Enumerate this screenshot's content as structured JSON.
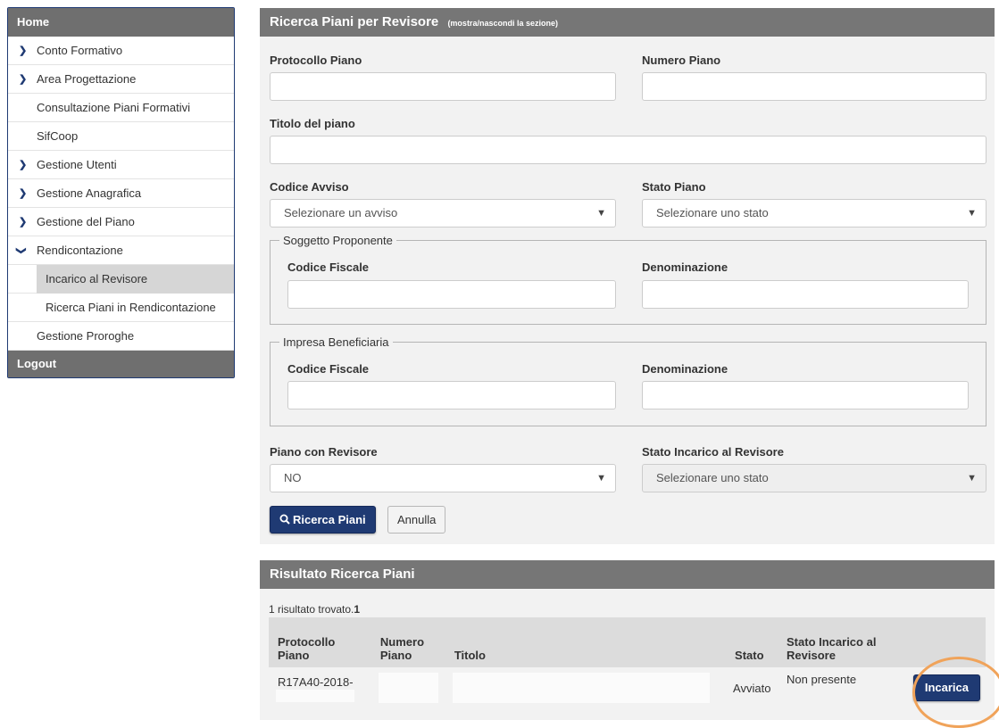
{
  "sidebar": {
    "home": "Home",
    "items": [
      {
        "label": "Conto Formativo",
        "icon": "chevron-right-icon",
        "glyph": "❯"
      },
      {
        "label": "Area Progettazione",
        "icon": "chevron-right-icon",
        "glyph": "❯"
      },
      {
        "label": "Consultazione Piani Formativi"
      },
      {
        "label": "SifCoop"
      },
      {
        "label": "Gestione Utenti",
        "icon": "chevron-right-icon",
        "glyph": "❯"
      },
      {
        "label": "Gestione Anagrafica",
        "icon": "chevron-right-icon",
        "glyph": "❯"
      },
      {
        "label": "Gestione del Piano",
        "icon": "chevron-right-icon",
        "glyph": "❯"
      },
      {
        "label": "Rendicontazione",
        "icon": "chevron-down-icon",
        "glyph": "❯"
      },
      {
        "label": "Incarico al Revisore",
        "active": true
      },
      {
        "label": "Ricerca Piani in Rendicontazione"
      },
      {
        "label": "Gestione Proroghe"
      }
    ],
    "logout": "Logout"
  },
  "search_panel": {
    "title": "Ricerca Piani per Revisore",
    "toggle": "(mostra/nascondi la sezione)",
    "protocollo_label": "Protocollo Piano",
    "protocollo_value": "",
    "numero_label": "Numero Piano",
    "numero_value": "",
    "titolo_label": "Titolo del piano",
    "titolo_value": "",
    "codice_avviso_label": "Codice Avviso",
    "codice_avviso_value": "Selezionare un avviso",
    "stato_piano_label": "Stato Piano",
    "stato_piano_value": "Selezionare uno stato",
    "soggetto": {
      "legend": "Soggetto Proponente",
      "cf_label": "Codice Fiscale",
      "den_label": "Denominazione"
    },
    "impresa": {
      "legend": "Impresa Beneficiaria",
      "cf_label": "Codice Fiscale",
      "den_label": "Denominazione"
    },
    "piano_revisore_label": "Piano con Revisore",
    "piano_revisore_value": "NO",
    "stato_incarico_label": "Stato Incarico al Revisore",
    "stato_incarico_value": "Selezionare uno stato",
    "search_button": "Ricerca Piani",
    "cancel_button": "Annulla",
    "dropdown_glyph": "▼",
    "search_glyph": "🔍"
  },
  "results": {
    "title": "Risultato Ricerca Piani",
    "count_text": "1 risultato trovato.",
    "count_bold": "1",
    "headers": {
      "protocollo_1": "Protocollo",
      "protocollo_2": "Piano",
      "numero_1": "Numero",
      "numero_2": "Piano",
      "titolo": "Titolo",
      "stato": "Stato",
      "incarico_1": "Stato Incarico al",
      "incarico_2": "Revisore"
    },
    "row": {
      "protocollo": "R17A40-2018-",
      "stato": "Avviato",
      "incarico": "Non presente",
      "action": "Incarica"
    }
  },
  "colors": {
    "primary": "#1f3a73",
    "header_gray": "#767676",
    "highlight": "#f0a35a"
  }
}
